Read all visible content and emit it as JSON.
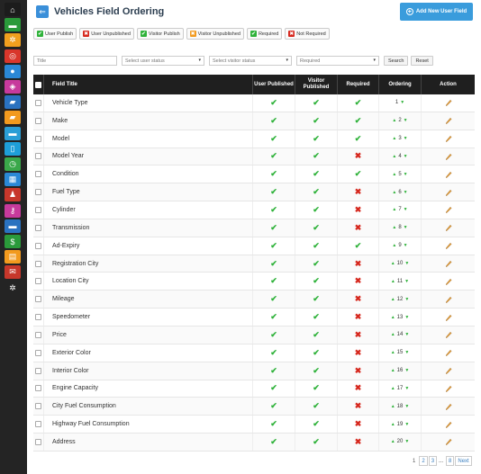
{
  "sidebar": {
    "items": [
      {
        "icon": "home-icon",
        "glyph": "⌂",
        "color": "#1c1c1c"
      },
      {
        "icon": "car-front-icon",
        "glyph": "▬",
        "color": "#2a9a3a"
      },
      {
        "icon": "gear-icon",
        "glyph": "✲",
        "color": "#f2a01e"
      },
      {
        "icon": "steering-wheel-icon",
        "glyph": "◎",
        "color": "#d9362b"
      },
      {
        "icon": "user-icon",
        "glyph": "●",
        "color": "#2a88d6"
      },
      {
        "icon": "cube-icon",
        "glyph": "◈",
        "color": "#c73a9c"
      },
      {
        "icon": "car-stack-icon",
        "glyph": "▰",
        "color": "#2a72c0"
      },
      {
        "icon": "truck-icon",
        "glyph": "▰",
        "color": "#f29a1e"
      },
      {
        "icon": "car-side-icon",
        "glyph": "▬",
        "color": "#2a9ed6"
      },
      {
        "icon": "mobile-icon",
        "glyph": "▯",
        "color": "#1e9fd8"
      },
      {
        "icon": "clock-icon",
        "glyph": "◷",
        "color": "#3aa84a"
      },
      {
        "icon": "calendar-icon",
        "glyph": "▦",
        "color": "#2a88d6"
      },
      {
        "icon": "user-tie-icon",
        "glyph": "♟",
        "color": "#c7372b"
      },
      {
        "icon": "key-icon",
        "glyph": "⚷",
        "color": "#c73a9c"
      },
      {
        "icon": "vehicle-icon",
        "glyph": "▬",
        "color": "#2a72c0"
      },
      {
        "icon": "money-icon",
        "glyph": "$",
        "color": "#2a9a3a"
      },
      {
        "icon": "report-icon",
        "glyph": "▤",
        "color": "#f29a1e"
      },
      {
        "icon": "mail-icon",
        "glyph": "✉",
        "color": "#c7372b"
      },
      {
        "icon": "settings-icon",
        "glyph": "✲",
        "color": "#242424"
      }
    ]
  },
  "header": {
    "title": "Vehicles Field Ordering",
    "add_button_label": "Add New User Field"
  },
  "actions": [
    {
      "label": "User Publish",
      "icon": "check-icon",
      "glyph": "✔",
      "color": "#2fb23a"
    },
    {
      "label": "User Unpublished",
      "icon": "cross-circle-icon",
      "glyph": "✖",
      "color": "#d6281e"
    },
    {
      "label": "Visitor Publish",
      "icon": "check-icon",
      "glyph": "✔",
      "color": "#2fb23a"
    },
    {
      "label": "Visitor Unpublished",
      "icon": "cross-square-icon",
      "glyph": "✖",
      "color": "#f29a1e"
    },
    {
      "label": "Required",
      "icon": "check-icon",
      "glyph": "✔",
      "color": "#2fb23a"
    },
    {
      "label": "Not Required",
      "icon": "cross-icon",
      "glyph": "✖",
      "color": "#d6281e"
    }
  ],
  "filters": {
    "title_placeholder": "Title",
    "user_status": "Select user status",
    "visitor_status": "Select visitor status",
    "required": "Required",
    "search_label": "Search",
    "reset_label": "Reset"
  },
  "table": {
    "columns": {
      "title": "Field Title",
      "user_published": "User Published",
      "visitor_published": "Visitor Published",
      "required": "Required",
      "ordering": "Ordering",
      "action": "Action"
    },
    "rows": [
      {
        "title": "Vehicle Type",
        "user": true,
        "visitor": true,
        "required": true,
        "order": "1"
      },
      {
        "title": "Make",
        "user": true,
        "visitor": true,
        "required": true,
        "order": "2"
      },
      {
        "title": "Model",
        "user": true,
        "visitor": true,
        "required": true,
        "order": "3"
      },
      {
        "title": "Model Year",
        "user": true,
        "visitor": true,
        "required": false,
        "order": "4"
      },
      {
        "title": "Condition",
        "user": true,
        "visitor": true,
        "required": true,
        "order": "5"
      },
      {
        "title": "Fuel Type",
        "user": true,
        "visitor": true,
        "required": false,
        "order": "6"
      },
      {
        "title": "Cylinder",
        "user": true,
        "visitor": true,
        "required": false,
        "order": "7"
      },
      {
        "title": "Transmission",
        "user": true,
        "visitor": true,
        "required": false,
        "order": "8"
      },
      {
        "title": "Ad-Expiry",
        "user": true,
        "visitor": true,
        "required": true,
        "order": "9"
      },
      {
        "title": "Registration City",
        "user": true,
        "visitor": true,
        "required": false,
        "order": "10"
      },
      {
        "title": "Location City",
        "user": true,
        "visitor": true,
        "required": false,
        "order": "11"
      },
      {
        "title": "Mileage",
        "user": true,
        "visitor": true,
        "required": false,
        "order": "12"
      },
      {
        "title": "Speedometer",
        "user": true,
        "visitor": true,
        "required": false,
        "order": "13"
      },
      {
        "title": "Price",
        "user": true,
        "visitor": true,
        "required": false,
        "order": "14"
      },
      {
        "title": "Exterior Color",
        "user": true,
        "visitor": true,
        "required": false,
        "order": "15"
      },
      {
        "title": "Interior Color",
        "user": true,
        "visitor": true,
        "required": false,
        "order": "16"
      },
      {
        "title": "Engine Capacity",
        "user": true,
        "visitor": true,
        "required": false,
        "order": "17"
      },
      {
        "title": "City Fuel Consumption",
        "user": true,
        "visitor": true,
        "required": false,
        "order": "18"
      },
      {
        "title": "Highway Fuel Consumption",
        "user": true,
        "visitor": true,
        "required": false,
        "order": "19"
      },
      {
        "title": "Address",
        "user": true,
        "visitor": true,
        "required": false,
        "order": "20"
      }
    ]
  },
  "pagination": {
    "current": "1",
    "pages": [
      "2",
      "3"
    ],
    "ellipsis": "...",
    "last": "8",
    "next": "Next"
  },
  "colors": {
    "accent": "#3a9cdc",
    "check": "#2fb23a",
    "cross": "#d6281e",
    "table_header": "#1f1f1f"
  }
}
